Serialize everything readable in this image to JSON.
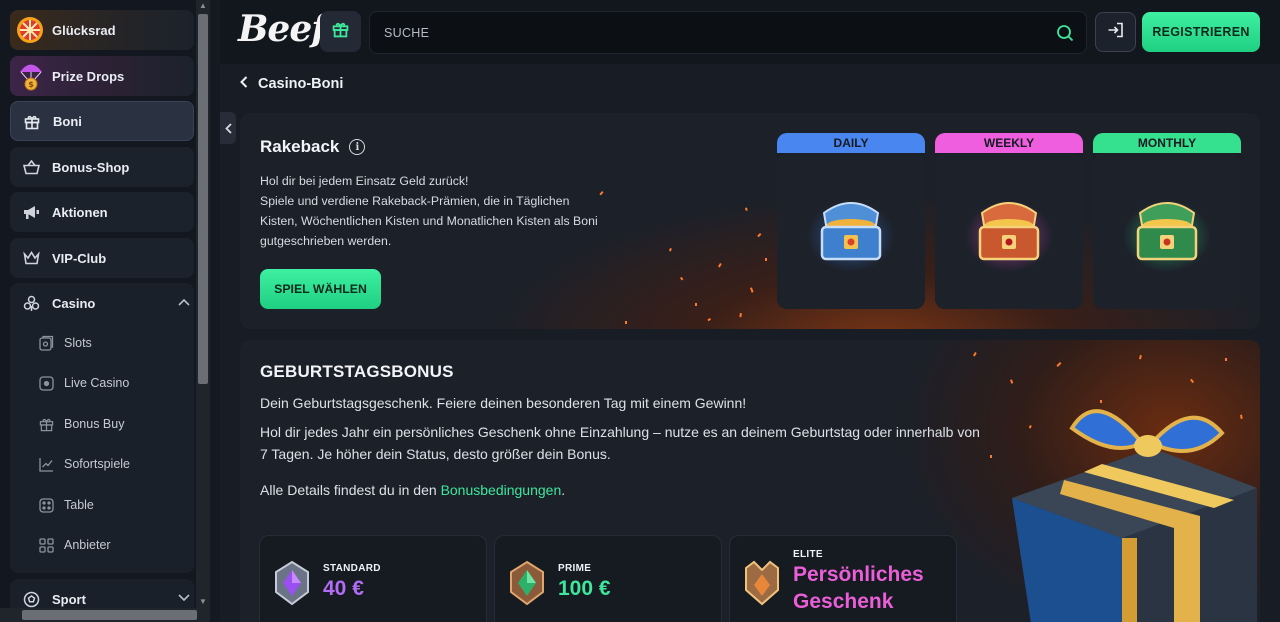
{
  "sidebar": {
    "items": [
      {
        "label": "Glücksrad",
        "icon": "wheel-of-fortune-icon"
      },
      {
        "label": "Prize Drops",
        "icon": "parachute-coin-icon"
      },
      {
        "label": "Boni",
        "icon": "gift-icon"
      },
      {
        "label": "Bonus-Shop",
        "icon": "shopping-basket-icon"
      },
      {
        "label": "Aktionen",
        "icon": "megaphone-icon"
      },
      {
        "label": "VIP-Club",
        "icon": "crown-icon"
      }
    ],
    "casino": {
      "label": "Casino",
      "icon": "cards-icon",
      "sub": [
        {
          "label": "Slots",
          "icon": "slot-icon"
        },
        {
          "label": "Live Casino",
          "icon": "live-icon"
        },
        {
          "label": "Bonus Buy",
          "icon": "gift-outline-icon"
        },
        {
          "label": "Sofortspiele",
          "icon": "chart-icon"
        },
        {
          "label": "Table",
          "icon": "dice-icon"
        },
        {
          "label": "Anbieter",
          "icon": "grid-icon"
        }
      ]
    },
    "sport": {
      "label": "Sport",
      "icon": "football-icon"
    }
  },
  "header": {
    "logo": "Beef",
    "search_placeholder": "SUCHE",
    "register_label": "REGISTRIEREN"
  },
  "breadcrumb": {
    "label": "Casino-Boni"
  },
  "rakeback": {
    "title": "Rakeback",
    "line1": "Hol dir bei jedem Einsatz Geld zurück!",
    "line2": "Spiele und verdiene Rakeback-Prämien, die in Täglichen Kisten, Wöchentlichen Kisten und Monatlichen Kisten als Boni gutgeschrieben werden.",
    "button": "SPIEL WÄHLEN",
    "chests": [
      {
        "label": "DAILY",
        "color": "#4a86f0"
      },
      {
        "label": "WEEKLY",
        "color": "#f05ee0"
      },
      {
        "label": "MONTHLY",
        "color": "#35e08f"
      }
    ]
  },
  "birthday": {
    "title": "GEBURTSTAGSBONUS",
    "p1": "Dein Geburtstagsgeschenk. Feiere deinen besonderen Tag mit einem Gewinn!",
    "p2": "Hol dir jedes Jahr ein persönliches Geschenk ohne Einzahlung – nutze es an deinem Geburtstag oder innerhalb von 7 Tagen. Je höher dein Status, desto größer dein Bonus.",
    "p3_prefix": "Alle Details findest du in den",
    "p3_link": "Bonusbedingungen",
    "p3_suffix": ".",
    "tiers": [
      {
        "name": "STANDARD",
        "value": "40 €",
        "color": "#b26cf5"
      },
      {
        "name": "PRIME",
        "value": "100 €",
        "color": "#3ee79c"
      },
      {
        "name": "ELITE",
        "value": "Persönliches Geschenk",
        "color": "#ea5fd8"
      }
    ]
  }
}
